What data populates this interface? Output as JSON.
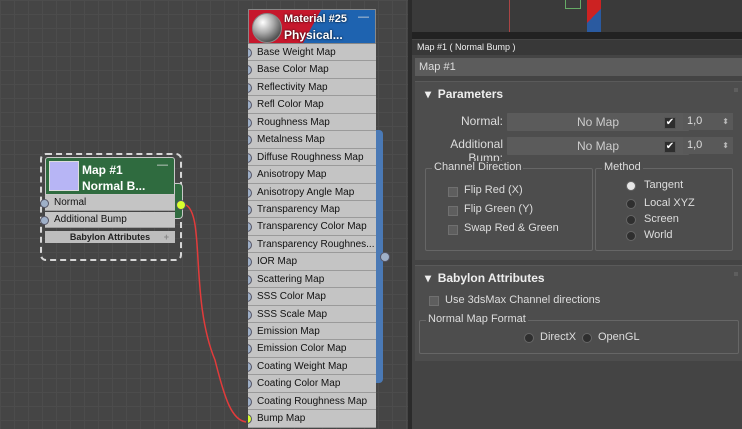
{
  "normal_bump_node": {
    "title_line1": "Map #1",
    "title_line2": "Normal B...",
    "minimize": "—",
    "inputs": [
      "Normal",
      "Additional Bump"
    ],
    "section": "Babylon Attributes",
    "section_plus": "+",
    "swatch_color": "#b7b5f5"
  },
  "material_node": {
    "title_line1": "Material #25",
    "title_line2": "Physical...",
    "minimize": "—",
    "slots": [
      "Base Weight Map",
      "Base Color Map",
      "Reflectivity Map",
      "Refl Color Map",
      "Roughness Map",
      "Metalness Map",
      "Diffuse Roughness Map",
      "Anisotropy Map",
      "Anisotropy Angle Map",
      "Transparency Map",
      "Transparency Color Map",
      "Transparency Roughnes...",
      "IOR Map",
      "Scattering Map",
      "SSS Color Map",
      "SSS Scale Map",
      "Emission Map",
      "Emission Color Map",
      "Coating Weight Map",
      "Coating Color Map",
      "Coating Roughness Map",
      "Bump Map"
    ]
  },
  "panel": {
    "title": "Map #1  ( Normal Bump )",
    "map_name": "Map #1",
    "parameters": {
      "header": "Parameters",
      "normal_label": "Normal:",
      "normal_button": "No Map",
      "normal_check": "✔",
      "normal_value": "1,0",
      "addbump_label": "Additional Bump:",
      "addbump_button": "No Map",
      "addbump_check": "✔",
      "addbump_value": "1,0",
      "spinner_arrows": "▲▼",
      "channel_direction": {
        "title": "Channel Direction",
        "options": [
          "Flip Red (X)",
          "Flip Green (Y)",
          "Swap Red & Green"
        ]
      },
      "method": {
        "title": "Method",
        "options": [
          "Tangent",
          "Local XYZ",
          "Screen",
          "World"
        ],
        "selected": "Tangent"
      }
    },
    "babylon": {
      "header": "Babylon Attributes",
      "use_channel_dirs": "Use 3dsMax Channel directions",
      "format_title": "Normal Map Format",
      "formats": [
        "DirectX",
        "OpenGL"
      ]
    }
  },
  "colors": {
    "wire": "#e23b3b",
    "accent_socket": "#d8ff2e",
    "node_green": "#2f6b3f",
    "material_blue": "#1e63b0"
  }
}
